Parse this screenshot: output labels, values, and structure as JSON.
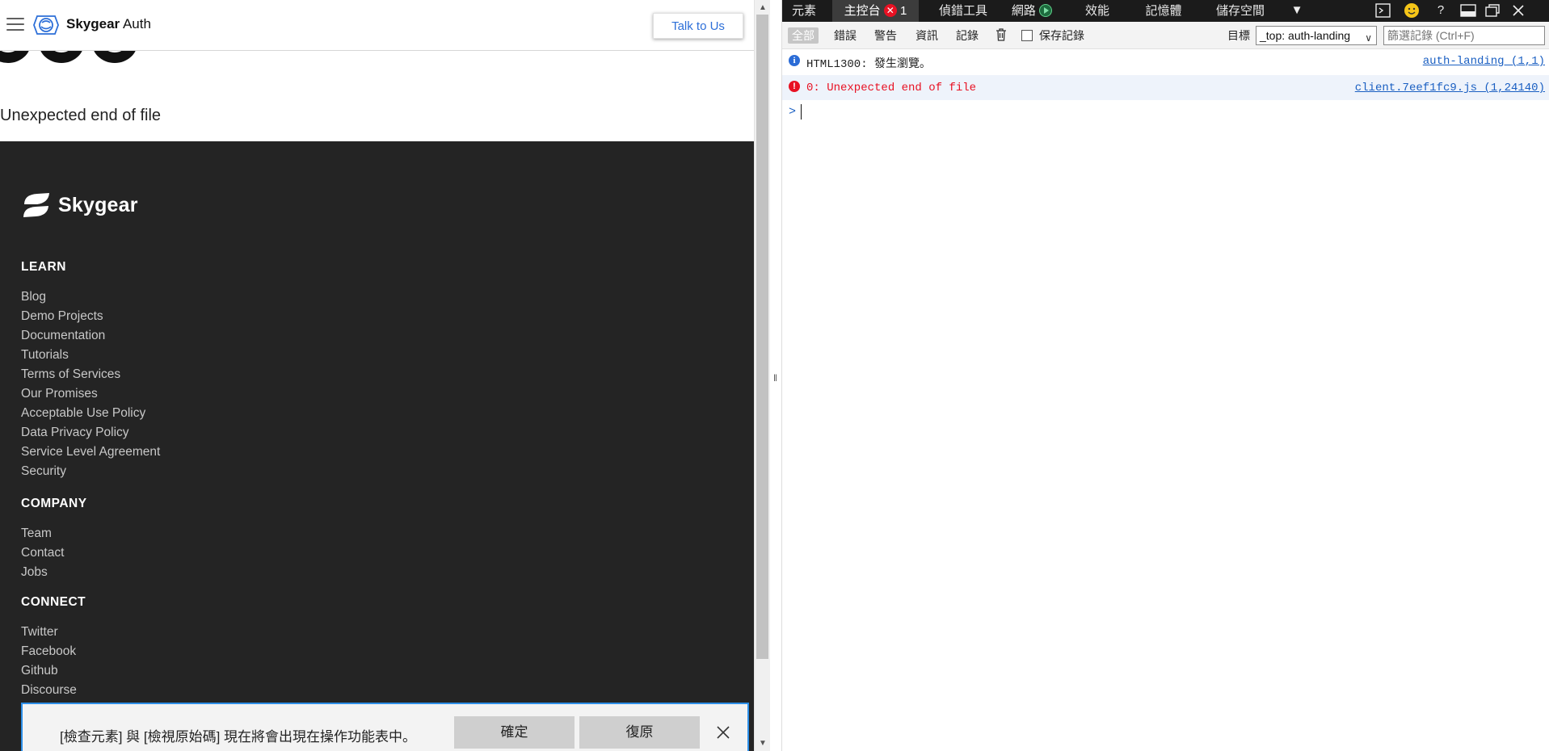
{
  "site": {
    "brand_bold": "Skygear",
    "brand_light": " Auth",
    "talk_button": "Talk to Us",
    "error_message": "Unexpected end of file",
    "footer": {
      "logo_text": "Skygear",
      "sections": [
        {
          "title": "LEARN",
          "links": [
            "Blog",
            "Demo Projects",
            "Documentation",
            "Tutorials",
            "Terms of Services",
            "Our Promises",
            "Acceptable Use Policy",
            "Data Privacy Policy",
            "Service Level Agreement",
            "Security"
          ]
        },
        {
          "title": "COMPANY",
          "links": [
            "Team",
            "Contact",
            "Jobs"
          ]
        },
        {
          "title": "CONNECT",
          "links": [
            "Twitter",
            "Facebook",
            "Github",
            "Discourse"
          ]
        }
      ]
    }
  },
  "notice": {
    "message": "[檢查元素] 與 [檢視原始碼] 現在將會出現在操作功能表中。",
    "ok": "確定",
    "revert": "復原"
  },
  "devtools": {
    "tabs": [
      "元素",
      "主控台",
      "偵錯工具",
      "網路",
      "效能",
      "記憶體",
      "儲存空間"
    ],
    "error_count": "1",
    "filters": [
      "全部",
      "錯誤",
      "警告",
      "資訊",
      "記錄"
    ],
    "preserve_log": "保存記錄",
    "target_label": "目標",
    "target_value": "_top: auth-landing",
    "filter_placeholder": "篩選記錄 (Ctrl+F)",
    "messages": [
      {
        "level": "info",
        "text": "HTML1300: 發生瀏覽。",
        "source": "auth-landing (1,1)"
      },
      {
        "level": "error",
        "text": "0: Unexpected end of file",
        "source": "client.7eef1fc9.js (1,24140)"
      }
    ],
    "prompt": ">"
  },
  "colors": {
    "footer_bg": "#242424",
    "link_blue": "#2d6fd8",
    "error_red": "#e81123",
    "devtools_tabbar": "#1b1b1b"
  }
}
